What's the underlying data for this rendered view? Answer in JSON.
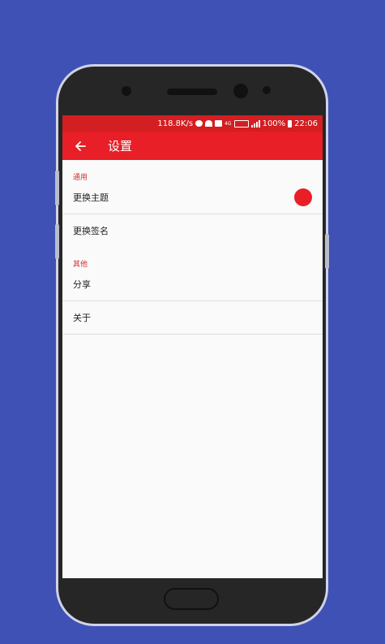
{
  "status_bar": {
    "speed": "118.8K/s",
    "network": "4G",
    "battery": "100%",
    "time": "22:06"
  },
  "app_bar": {
    "back_icon": "arrow-left-icon",
    "title": "设置"
  },
  "sections": [
    {
      "header": "通用",
      "items": [
        {
          "label": "更换主题",
          "accent": "#e81f27"
        },
        {
          "label": "更换签名"
        }
      ]
    },
    {
      "header": "其他",
      "items": [
        {
          "label": "分享"
        },
        {
          "label": "关于"
        }
      ]
    }
  ],
  "colors": {
    "background": "#3f51b5",
    "status_bar": "#d31e22",
    "app_bar": "#e81f27",
    "section_header": "#d32f2f"
  }
}
